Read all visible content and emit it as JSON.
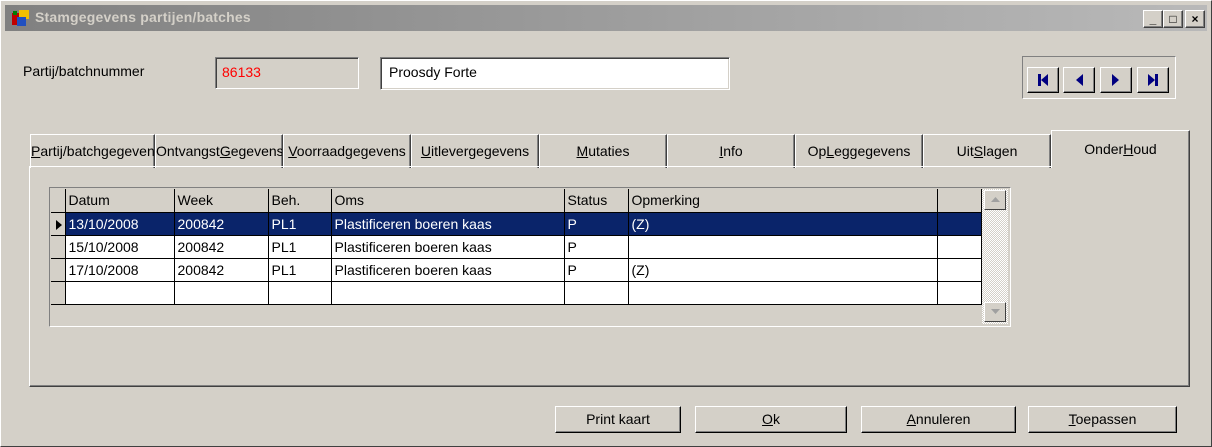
{
  "window": {
    "title": "Stamgegevens partijen/batches",
    "minimize_glyph": "_",
    "maximize_glyph": "□",
    "close_glyph": "×"
  },
  "header": {
    "batch_label": "Partij/batchnummer",
    "batch_number": "86133",
    "product_name": "Proosdy Forte"
  },
  "navigation": {
    "icons": [
      "first-record-icon",
      "previous-record-icon",
      "next-record-icon",
      "last-record-icon"
    ]
  },
  "tabs": [
    {
      "pre": "",
      "u": "P",
      "post": "artij/batchgegevens",
      "name": "tab-partij-batchgegevens"
    },
    {
      "pre": "Ontvangst",
      "u": "G",
      "post": "egevens",
      "name": "tab-ontvangstgegevens"
    },
    {
      "pre": "",
      "u": "V",
      "post": "oorraadgegevens",
      "name": "tab-voorraadgegevens"
    },
    {
      "pre": "",
      "u": "U",
      "post": "itlevergegevens",
      "name": "tab-uitlevergegevens"
    },
    {
      "pre": "",
      "u": "M",
      "post": "utaties",
      "name": "tab-mutaties"
    },
    {
      "pre": "",
      "u": "I",
      "post": "nfo",
      "name": "tab-info"
    },
    {
      "pre": "Op",
      "u": "L",
      "post": "eggegevens",
      "name": "tab-opleggegevens"
    },
    {
      "pre": "Uit",
      "u": "S",
      "post": "lagen",
      "name": "tab-uitslagen"
    },
    {
      "pre": "Onder",
      "u": "H",
      "post": "oud",
      "name": "tab-onderhoud",
      "active": true
    }
  ],
  "grid": {
    "columns": [
      "Datum",
      "Week",
      "Beh.",
      "Oms",
      "Status",
      "Opmerking",
      ""
    ],
    "rows": [
      {
        "datum": "13/10/2008",
        "week": "200842",
        "beh": "PL1",
        "oms": "Plastificeren boeren kaas",
        "status": "P",
        "opmerking": "(Z)",
        "selected": true
      },
      {
        "datum": "15/10/2008",
        "week": "200842",
        "beh": "PL1",
        "oms": "Plastificeren boeren kaas",
        "status": "P",
        "opmerking": ""
      },
      {
        "datum": "17/10/2008",
        "week": "200842",
        "beh": "PL1",
        "oms": "Plastificeren boeren kaas",
        "status": "P",
        "opmerking": "(Z)"
      },
      {
        "datum": "",
        "week": "",
        "beh": "",
        "oms": "",
        "status": "",
        "opmerking": ""
      }
    ]
  },
  "buttons": {
    "print": {
      "pre": "Print kaart",
      "u": "",
      "post": ""
    },
    "ok": {
      "pre": "",
      "u": "O",
      "post": "k"
    },
    "cancel": {
      "pre": "",
      "u": "A",
      "post": "nnuleren"
    },
    "apply": {
      "pre": "",
      "u": "T",
      "post": "oepassen"
    }
  },
  "colors": {
    "face": "#d4d0c8",
    "selection": "#0a246a",
    "batch_number": "#ff0000",
    "nav_arrow": "#000080"
  }
}
